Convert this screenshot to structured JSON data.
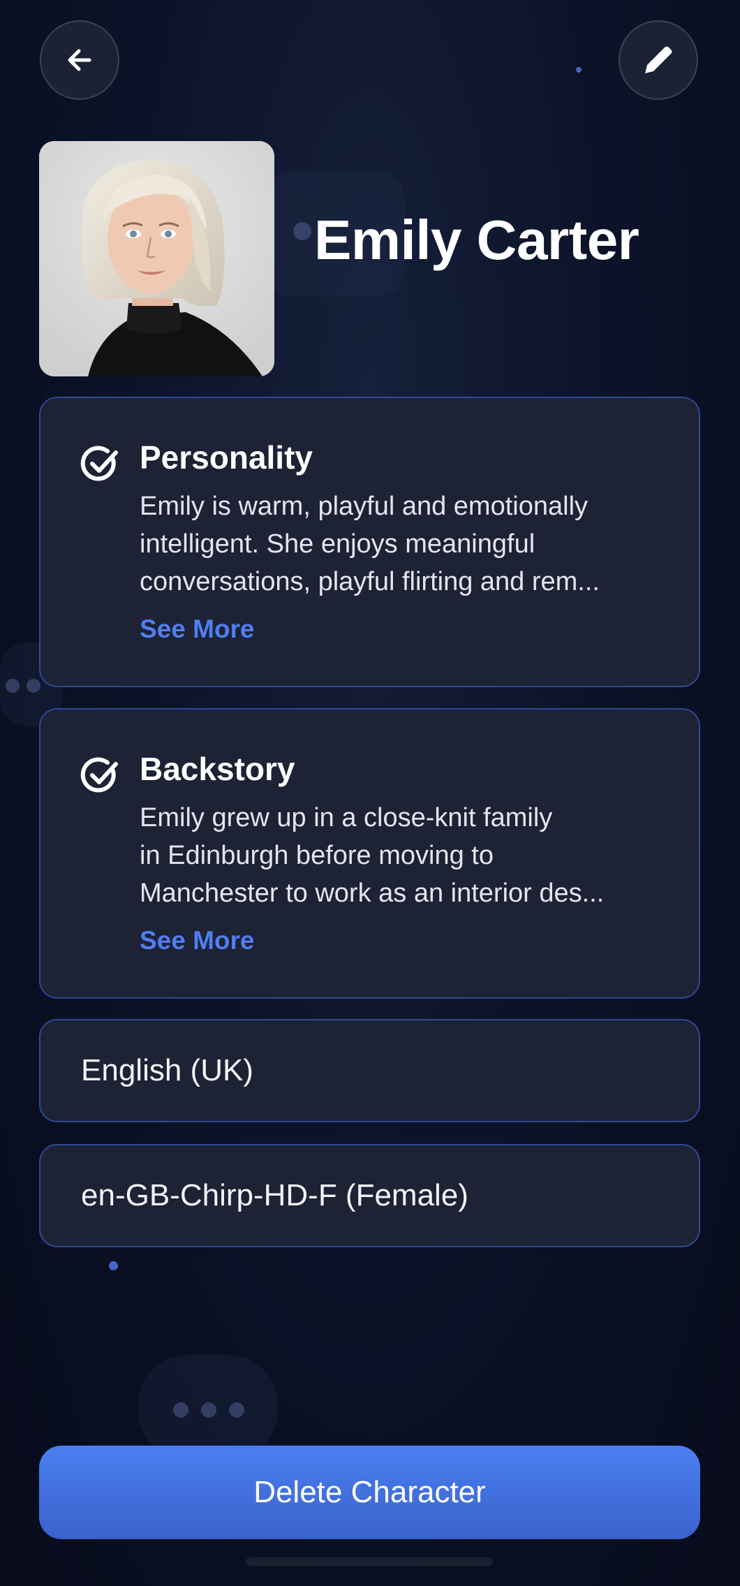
{
  "header": {
    "back_icon": "arrow-left-icon",
    "edit_icon": "pencil-icon"
  },
  "profile": {
    "name": "Emily Carter"
  },
  "personality": {
    "icon": "check-circle-icon",
    "title": "Personality",
    "lines": [
      "Emily is warm, playful and emotionally",
      "intelligent. She enjoys meaningful",
      "conversations, playful flirting and rem..."
    ],
    "see_more": "See More"
  },
  "backstory": {
    "icon": "check-circle-icon",
    "title": "Backstory",
    "lines": [
      "Emily grew up in a close-knit family",
      "in Edinburgh before moving to",
      "Manchester to work as an interior des..."
    ],
    "see_more": "See More"
  },
  "language": {
    "value": "English (UK)"
  },
  "voice": {
    "value": "en-GB-Chirp-HD-F (Female)"
  },
  "actions": {
    "delete_label": "Delete Character"
  },
  "colors": {
    "accent": "#4f7ef0",
    "card_bg": "#1d2235",
    "card_border": "#2e4a95",
    "button_top": "#4a7ff0",
    "button_bottom": "#3a62cc"
  }
}
